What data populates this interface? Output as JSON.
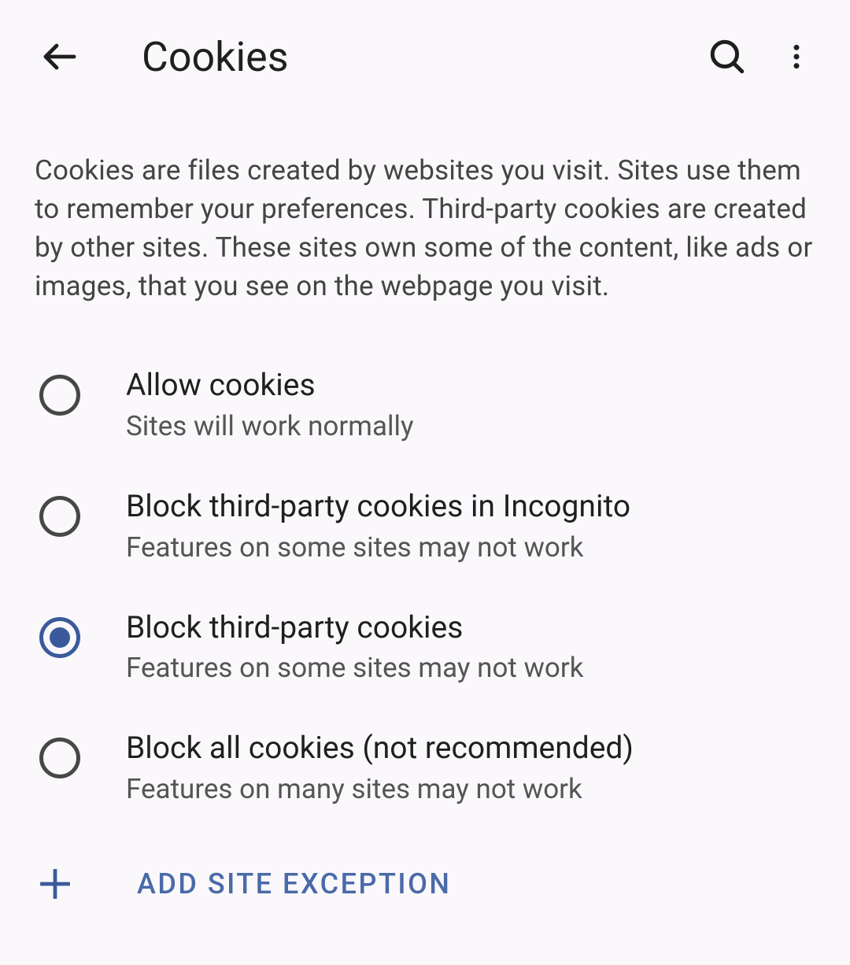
{
  "header": {
    "title": "Cookies"
  },
  "description": "Cookies are files created by websites you visit. Sites use them to remember your preferences. Third-party cookies are created by other sites. These sites own some of the content, like ads or images, that you see on the webpage you visit.",
  "options": [
    {
      "title": "Allow cookies",
      "subtitle": "Sites will work normally",
      "selected": false
    },
    {
      "title": "Block third-party cookies in Incognito",
      "subtitle": "Features on some sites may not work",
      "selected": false
    },
    {
      "title": "Block third-party cookies",
      "subtitle": "Features on some sites may not work",
      "selected": true
    },
    {
      "title": "Block all cookies (not recommended)",
      "subtitle": "Features on many sites may not work",
      "selected": false
    }
  ],
  "addException": {
    "label": "ADD SITE EXCEPTION"
  }
}
